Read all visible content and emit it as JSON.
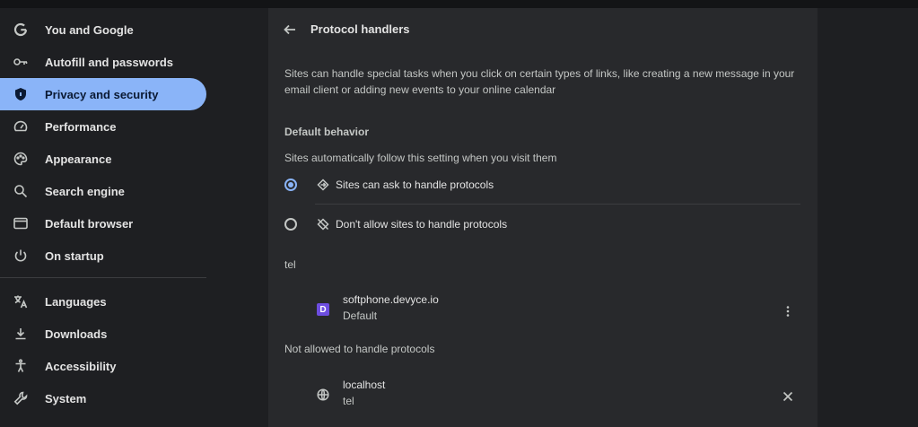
{
  "sidebar": {
    "items": [
      {
        "label": "You and Google",
        "icon": "google-g-icon"
      },
      {
        "label": "Autofill and passwords",
        "icon": "key-icon"
      },
      {
        "label": "Privacy and security",
        "icon": "shield-icon",
        "active": true
      },
      {
        "label": "Performance",
        "icon": "speedometer-icon"
      },
      {
        "label": "Appearance",
        "icon": "palette-icon"
      },
      {
        "label": "Search engine",
        "icon": "search-icon"
      },
      {
        "label": "Default browser",
        "icon": "browser-window-icon"
      },
      {
        "label": "On startup",
        "icon": "power-icon"
      },
      {
        "label": "Languages",
        "icon": "translate-icon"
      },
      {
        "label": "Downloads",
        "icon": "download-icon"
      },
      {
        "label": "Accessibility",
        "icon": "accessibility-icon"
      },
      {
        "label": "System",
        "icon": "wrench-icon"
      }
    ]
  },
  "header": {
    "title": "Protocol handlers",
    "back_icon": "arrow-back-icon"
  },
  "description": "Sites can handle special tasks when you click on certain types of links, like creating a new message in your email client or adding new events to your online calendar",
  "default_behavior": {
    "title": "Default behavior",
    "subtitle": "Sites automatically follow this setting when you visit them",
    "options": [
      {
        "label": "Sites can ask to handle protocols",
        "icon": "protocol-handler-icon",
        "checked": true
      },
      {
        "label": "Don't allow sites to handle protocols",
        "icon": "protocol-handler-off-icon",
        "checked": false
      }
    ]
  },
  "allowed": {
    "group_label": "tel",
    "sites": [
      {
        "name": "softphone.devyce.io",
        "detail": "Default",
        "favicon_letter": "D",
        "favicon_color": "#6d4de0",
        "action_icon": "more-vert-icon"
      }
    ]
  },
  "blocked": {
    "title": "Not allowed to handle protocols",
    "sites": [
      {
        "name": "localhost",
        "detail": "tel",
        "icon": "globe-icon",
        "action_icon": "close-icon"
      }
    ]
  },
  "colors": {
    "accent": "#8ab4f8",
    "background": "#1e1f22",
    "card": "#28292c"
  }
}
